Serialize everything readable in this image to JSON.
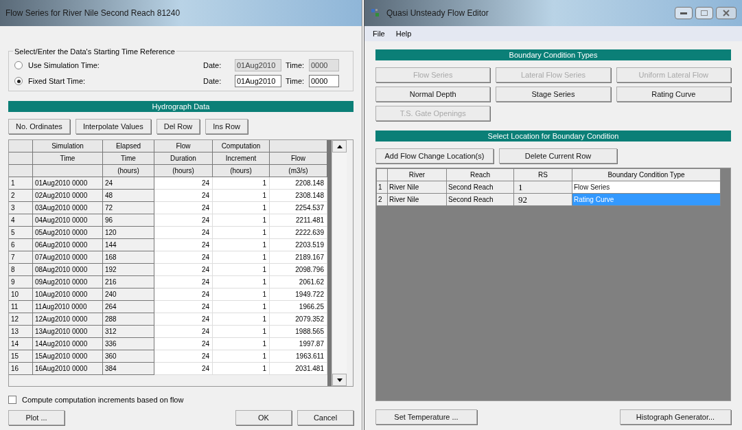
{
  "flow_window": {
    "title": "Flow Series for River Nile Second Reach 81240",
    "time_reference": {
      "title": "Select/Enter the Data's Starting Time Reference",
      "options": [
        {
          "label": "Use Simulation Time:",
          "selected": false,
          "date_label": "Date:",
          "date": "01Aug2010",
          "time_label": "Time:",
          "time": "0000",
          "disabled": true
        },
        {
          "label": "Fixed Start Time:",
          "selected": true,
          "date_label": "Date:",
          "date": "01Aug2010",
          "time_label": "Time:",
          "time": "0000",
          "disabled": false
        }
      ]
    },
    "hydrograph_header": "Hydrograph Data",
    "buttons": [
      "No. Ordinates",
      "Interpolate Values",
      "Del Row",
      "Ins Row"
    ],
    "table": {
      "header_rows": [
        [
          "",
          "Simulation",
          "Elapsed",
          "Flow",
          "Computation",
          ""
        ],
        [
          "",
          "Time",
          "Time",
          "Duration",
          "Increment",
          "Flow"
        ],
        [
          "",
          "",
          "(hours)",
          "(hours)",
          "(hours)",
          "(m3/s)"
        ]
      ],
      "rows": [
        [
          "1",
          "01Aug2010 0000",
          "24",
          "24",
          "1",
          "2208.148"
        ],
        [
          "2",
          "02Aug2010 0000",
          "48",
          "24",
          "1",
          "2308.148"
        ],
        [
          "3",
          "03Aug2010 0000",
          "72",
          "24",
          "1",
          "2254.537"
        ],
        [
          "4",
          "04Aug2010 0000",
          "96",
          "24",
          "1",
          "2211.481"
        ],
        [
          "5",
          "05Aug2010 0000",
          "120",
          "24",
          "1",
          "2222.639"
        ],
        [
          "6",
          "06Aug2010 0000",
          "144",
          "24",
          "1",
          "2203.519"
        ],
        [
          "7",
          "07Aug2010 0000",
          "168",
          "24",
          "1",
          "2189.167"
        ],
        [
          "8",
          "08Aug2010 0000",
          "192",
          "24",
          "1",
          "2098.796"
        ],
        [
          "9",
          "09Aug2010 0000",
          "216",
          "24",
          "1",
          "2061.62"
        ],
        [
          "10",
          "10Aug2010 0000",
          "240",
          "24",
          "1",
          "1949.722"
        ],
        [
          "11",
          "11Aug2010 0000",
          "264",
          "24",
          "1",
          "1966.25"
        ],
        [
          "12",
          "12Aug2010 0000",
          "288",
          "24",
          "1",
          "2079.352"
        ],
        [
          "13",
          "13Aug2010 0000",
          "312",
          "24",
          "1",
          "1988.565"
        ],
        [
          "14",
          "14Aug2010 0000",
          "336",
          "24",
          "1",
          "1997.87"
        ],
        [
          "15",
          "15Aug2010 0000",
          "360",
          "24",
          "1",
          "1963.611"
        ],
        [
          "16",
          "16Aug2010 0000",
          "384",
          "24",
          "1",
          "2031.481"
        ]
      ]
    },
    "compute_checkbox": {
      "label": "Compute computation increments based on flow",
      "checked": false
    },
    "plot_button": "Plot ...",
    "ok_button": "OK",
    "cancel_button": "Cancel"
  },
  "editor_window": {
    "title": "Quasi Unsteady Flow Editor",
    "menu": [
      "File",
      "Help"
    ],
    "bc_header": "Boundary Condition Types",
    "bc_buttons": [
      {
        "label": "Flow Series",
        "disabled": true
      },
      {
        "label": "Lateral Flow Series",
        "disabled": true
      },
      {
        "label": "Uniform Lateral Flow",
        "disabled": true
      },
      {
        "label": "Normal Depth",
        "disabled": false
      },
      {
        "label": "Stage Series",
        "disabled": false
      },
      {
        "label": "Rating Curve",
        "disabled": false
      },
      {
        "label": "T.S. Gate Openings",
        "disabled": true
      }
    ],
    "location_header": "Select Location for Boundary Condition",
    "location_buttons": [
      "Add Flow Change Location(s)",
      "Delete Current Row"
    ],
    "table": {
      "columns": [
        "River",
        "Reach",
        "RS",
        "Boundary Condition Type"
      ],
      "rows": [
        {
          "n": "1",
          "river": "River Nile",
          "reach": "Second Reach",
          "rs": "1",
          "type": "Flow Series",
          "selected": false
        },
        {
          "n": "2",
          "river": "River Nile",
          "reach": "Second Reach",
          "rs": "92",
          "type": "Rating Curve",
          "selected": true
        }
      ]
    },
    "bottom_buttons": [
      "Set Temperature ...",
      "Histograph Generator..."
    ]
  }
}
